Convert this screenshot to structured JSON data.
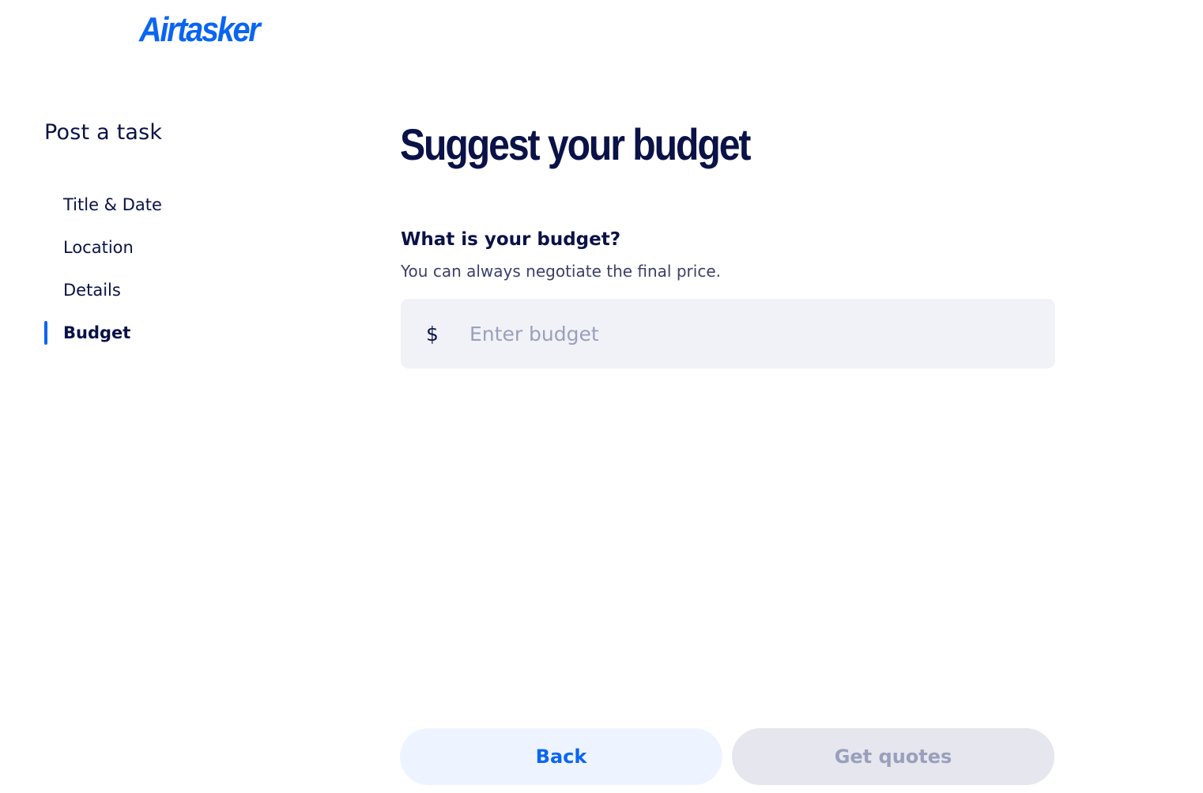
{
  "brand": {
    "logo_text": "Airtasker",
    "accent_color": "#0a65f2",
    "text_color": "#0a1247"
  },
  "sidebar": {
    "title": "Post a task",
    "steps": [
      {
        "label": "Title & Date",
        "active": false
      },
      {
        "label": "Location",
        "active": false
      },
      {
        "label": "Details",
        "active": false
      },
      {
        "label": "Budget",
        "active": true
      }
    ]
  },
  "main": {
    "heading": "Suggest your budget",
    "question": "What is your budget?",
    "hint": "You can always negotiate the final price.",
    "budget_input": {
      "currency_symbol": "$",
      "value": "",
      "placeholder": "Enter budget"
    }
  },
  "footer": {
    "back_label": "Back",
    "get_quotes_label": "Get quotes",
    "get_quotes_disabled": true
  }
}
